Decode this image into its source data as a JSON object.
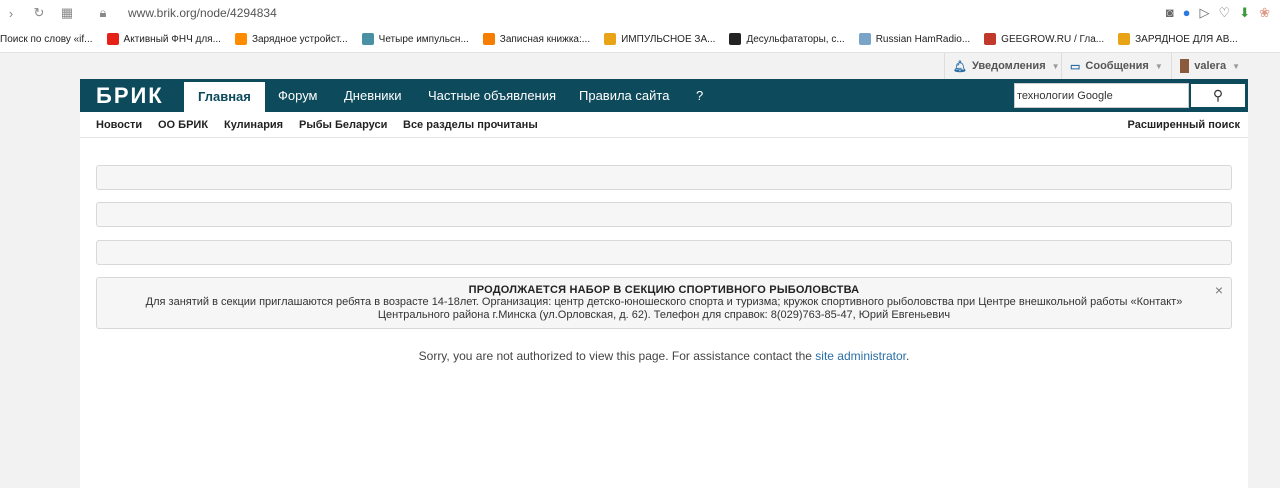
{
  "browser": {
    "url": "www.brik.org/node/4294834",
    "bookmarks": [
      {
        "label": "Поиск по слову «if...",
        "icon": "text-icon",
        "color": "#ffffff"
      },
      {
        "label": "Активный ФНЧ для...",
        "icon": "youtube-icon",
        "color": "#e62117"
      },
      {
        "label": "Зарядное устройст...",
        "icon": "ra-icon",
        "color": "#ff8c00"
      },
      {
        "label": "Четыре импульсн...",
        "icon": "site-icon",
        "color": "#4a90a4"
      },
      {
        "label": "Записная книжка:...",
        "icon": "blogger-icon",
        "color": "#f57d00"
      },
      {
        "label": "ИМПУЛЬСНОЕ ЗА...",
        "icon": "rf-icon",
        "color": "#e8a317"
      },
      {
        "label": "Десульфататоры, с...",
        "icon": "ball-icon",
        "color": "#222222"
      },
      {
        "label": "Russian HamRadio...",
        "icon": "ham-icon",
        "color": "#7aa3c8"
      },
      {
        "label": "GEEGROW.RU / Гла...",
        "icon": "shield-icon",
        "color": "#c0392b"
      },
      {
        "label": "ЗАРЯДНОЕ ДЛЯ АВ...",
        "icon": "rf-icon",
        "color": "#e8a317"
      }
    ]
  },
  "userbar": {
    "notifications": "Уведомления",
    "messages": "Сообщения",
    "user": "valera"
  },
  "site": {
    "logo": "БРИК",
    "nav": [
      "Главная",
      "Форум",
      "Дневники",
      "Частные объявления",
      "Правила сайта",
      "?"
    ],
    "search_value": "технологии Google",
    "subnav": [
      "Новости",
      "ОО БРИК",
      "Кулинария",
      "Рыбы Беларуси",
      "Все разделы прочитаны"
    ],
    "advanced_search": "Расширенный поиск"
  },
  "notice": {
    "title": "ПРОДОЛЖАЕТСЯ НАБОР В СЕКЦИЮ СПОРТИВНОГО РЫБОЛОВСТВА",
    "line1": "Для занятий в секции приглашаются ребята в возрасте 14-18лет. Организация: центр детско-юношеского спорта и туризма; кружок спортивного рыболовства при Центре внешкольной работы «Контакт»",
    "line2": "Центрального района г.Минска (ул.Орловская, д. 62). Телефон для справок: 8(029)763-85-47, Юрий Евгеньевич",
    "close": "×"
  },
  "message": {
    "text": "Sorry, you are not authorized to view this page. For assistance contact the ",
    "link": "site administrator",
    "end": "."
  },
  "colors": {
    "navbar": "#0d4a5c",
    "link": "#2a6ea6"
  }
}
